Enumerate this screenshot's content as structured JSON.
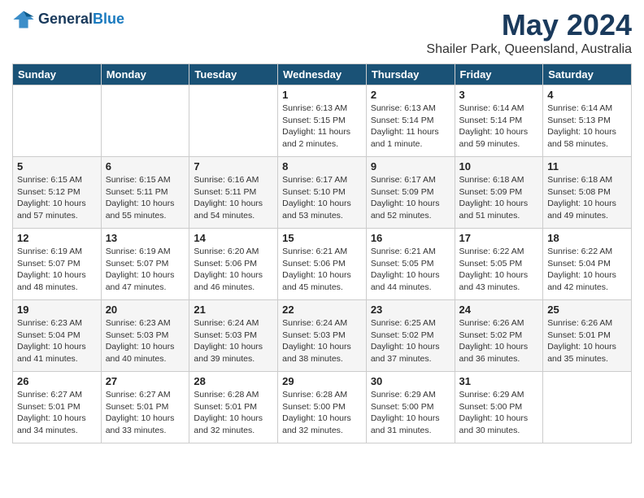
{
  "header": {
    "logo_line1": "General",
    "logo_line2": "Blue",
    "main_title": "May 2024",
    "subtitle": "Shailer Park, Queensland, Australia"
  },
  "calendar": {
    "days_of_week": [
      "Sunday",
      "Monday",
      "Tuesday",
      "Wednesday",
      "Thursday",
      "Friday",
      "Saturday"
    ],
    "weeks": [
      [
        {
          "date": "",
          "info": ""
        },
        {
          "date": "",
          "info": ""
        },
        {
          "date": "",
          "info": ""
        },
        {
          "date": "1",
          "info": "Sunrise: 6:13 AM\nSunset: 5:15 PM\nDaylight: 11 hours\nand 2 minutes."
        },
        {
          "date": "2",
          "info": "Sunrise: 6:13 AM\nSunset: 5:14 PM\nDaylight: 11 hours\nand 1 minute."
        },
        {
          "date": "3",
          "info": "Sunrise: 6:14 AM\nSunset: 5:14 PM\nDaylight: 10 hours\nand 59 minutes."
        },
        {
          "date": "4",
          "info": "Sunrise: 6:14 AM\nSunset: 5:13 PM\nDaylight: 10 hours\nand 58 minutes."
        }
      ],
      [
        {
          "date": "5",
          "info": "Sunrise: 6:15 AM\nSunset: 5:12 PM\nDaylight: 10 hours\nand 57 minutes."
        },
        {
          "date": "6",
          "info": "Sunrise: 6:15 AM\nSunset: 5:11 PM\nDaylight: 10 hours\nand 55 minutes."
        },
        {
          "date": "7",
          "info": "Sunrise: 6:16 AM\nSunset: 5:11 PM\nDaylight: 10 hours\nand 54 minutes."
        },
        {
          "date": "8",
          "info": "Sunrise: 6:17 AM\nSunset: 5:10 PM\nDaylight: 10 hours\nand 53 minutes."
        },
        {
          "date": "9",
          "info": "Sunrise: 6:17 AM\nSunset: 5:09 PM\nDaylight: 10 hours\nand 52 minutes."
        },
        {
          "date": "10",
          "info": "Sunrise: 6:18 AM\nSunset: 5:09 PM\nDaylight: 10 hours\nand 51 minutes."
        },
        {
          "date": "11",
          "info": "Sunrise: 6:18 AM\nSunset: 5:08 PM\nDaylight: 10 hours\nand 49 minutes."
        }
      ],
      [
        {
          "date": "12",
          "info": "Sunrise: 6:19 AM\nSunset: 5:07 PM\nDaylight: 10 hours\nand 48 minutes."
        },
        {
          "date": "13",
          "info": "Sunrise: 6:19 AM\nSunset: 5:07 PM\nDaylight: 10 hours\nand 47 minutes."
        },
        {
          "date": "14",
          "info": "Sunrise: 6:20 AM\nSunset: 5:06 PM\nDaylight: 10 hours\nand 46 minutes."
        },
        {
          "date": "15",
          "info": "Sunrise: 6:21 AM\nSunset: 5:06 PM\nDaylight: 10 hours\nand 45 minutes."
        },
        {
          "date": "16",
          "info": "Sunrise: 6:21 AM\nSunset: 5:05 PM\nDaylight: 10 hours\nand 44 minutes."
        },
        {
          "date": "17",
          "info": "Sunrise: 6:22 AM\nSunset: 5:05 PM\nDaylight: 10 hours\nand 43 minutes."
        },
        {
          "date": "18",
          "info": "Sunrise: 6:22 AM\nSunset: 5:04 PM\nDaylight: 10 hours\nand 42 minutes."
        }
      ],
      [
        {
          "date": "19",
          "info": "Sunrise: 6:23 AM\nSunset: 5:04 PM\nDaylight: 10 hours\nand 41 minutes."
        },
        {
          "date": "20",
          "info": "Sunrise: 6:23 AM\nSunset: 5:03 PM\nDaylight: 10 hours\nand 40 minutes."
        },
        {
          "date": "21",
          "info": "Sunrise: 6:24 AM\nSunset: 5:03 PM\nDaylight: 10 hours\nand 39 minutes."
        },
        {
          "date": "22",
          "info": "Sunrise: 6:24 AM\nSunset: 5:03 PM\nDaylight: 10 hours\nand 38 minutes."
        },
        {
          "date": "23",
          "info": "Sunrise: 6:25 AM\nSunset: 5:02 PM\nDaylight: 10 hours\nand 37 minutes."
        },
        {
          "date": "24",
          "info": "Sunrise: 6:26 AM\nSunset: 5:02 PM\nDaylight: 10 hours\nand 36 minutes."
        },
        {
          "date": "25",
          "info": "Sunrise: 6:26 AM\nSunset: 5:01 PM\nDaylight: 10 hours\nand 35 minutes."
        }
      ],
      [
        {
          "date": "26",
          "info": "Sunrise: 6:27 AM\nSunset: 5:01 PM\nDaylight: 10 hours\nand 34 minutes."
        },
        {
          "date": "27",
          "info": "Sunrise: 6:27 AM\nSunset: 5:01 PM\nDaylight: 10 hours\nand 33 minutes."
        },
        {
          "date": "28",
          "info": "Sunrise: 6:28 AM\nSunset: 5:01 PM\nDaylight: 10 hours\nand 32 minutes."
        },
        {
          "date": "29",
          "info": "Sunrise: 6:28 AM\nSunset: 5:00 PM\nDaylight: 10 hours\nand 32 minutes."
        },
        {
          "date": "30",
          "info": "Sunrise: 6:29 AM\nSunset: 5:00 PM\nDaylight: 10 hours\nand 31 minutes."
        },
        {
          "date": "31",
          "info": "Sunrise: 6:29 AM\nSunset: 5:00 PM\nDaylight: 10 hours\nand 30 minutes."
        },
        {
          "date": "",
          "info": ""
        }
      ]
    ]
  }
}
